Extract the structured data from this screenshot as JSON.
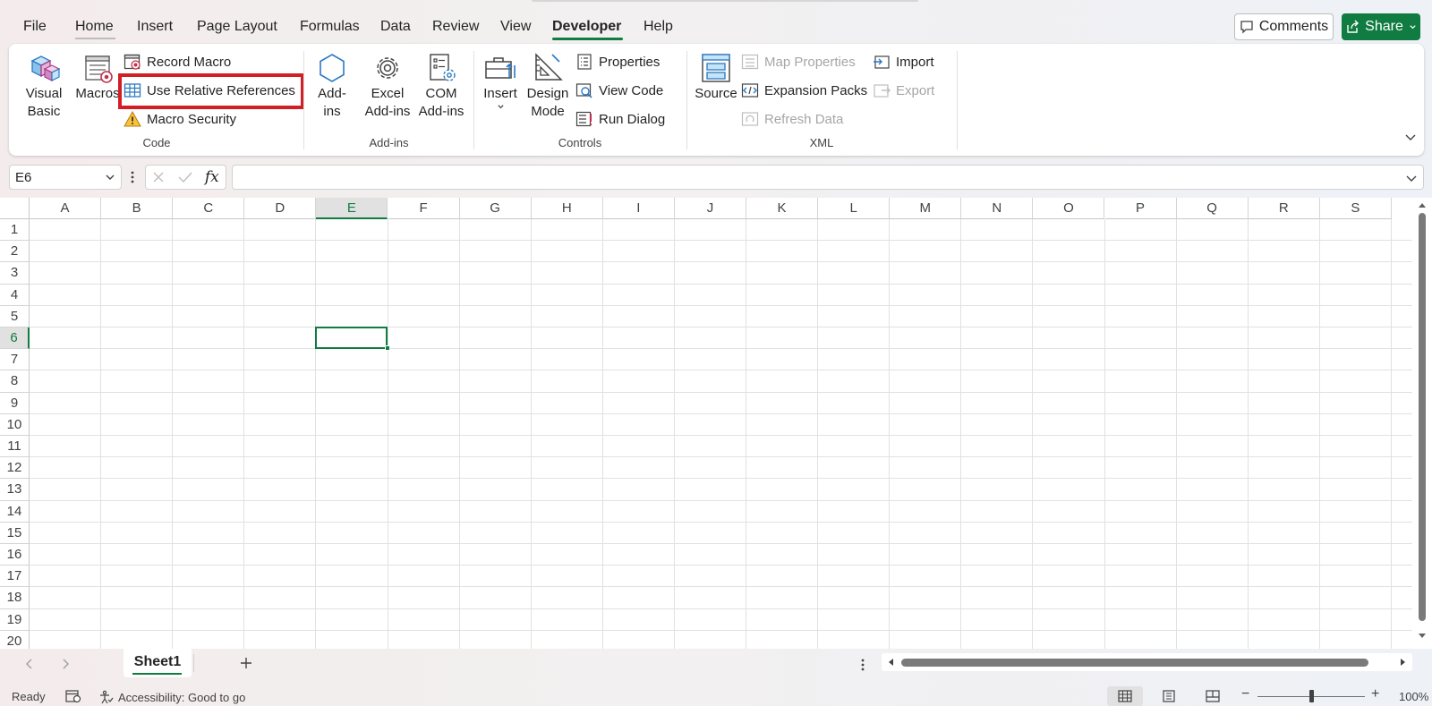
{
  "menu": {
    "tabs": [
      {
        "label": "File"
      },
      {
        "label": "Home"
      },
      {
        "label": "Insert"
      },
      {
        "label": "Page Layout"
      },
      {
        "label": "Formulas"
      },
      {
        "label": "Data"
      },
      {
        "label": "Review"
      },
      {
        "label": "View"
      },
      {
        "label": "Developer"
      },
      {
        "label": "Help"
      }
    ],
    "active_tab": "Developer",
    "comments_label": "Comments",
    "share_label": "Share"
  },
  "ribbon": {
    "code": {
      "group_label": "Code",
      "visual_basic": "Visual\nBasic",
      "macros": "Macros",
      "record_macro": "Record Macro",
      "use_relative_references": "Use Relative References",
      "macro_security": "Macro Security"
    },
    "addins": {
      "group_label": "Add-ins",
      "add_ins": "Add-\nins",
      "excel_add_ins": "Excel\nAdd-ins",
      "com_add_ins": "COM\nAdd-ins"
    },
    "controls": {
      "group_label": "Controls",
      "insert": "Insert",
      "design_mode": "Design\nMode",
      "properties": "Properties",
      "view_code": "View Code",
      "run_dialog": "Run Dialog"
    },
    "xml": {
      "group_label": "XML",
      "source": "Source",
      "map_properties": "Map Properties",
      "expansion_packs": "Expansion Packs",
      "refresh_data": "Refresh Data",
      "import": "Import",
      "export": "Export"
    }
  },
  "formula_bar": {
    "name_box": "E6",
    "fx_label": "fx",
    "formula_value": ""
  },
  "grid": {
    "columns": [
      "A",
      "B",
      "C",
      "D",
      "E",
      "F",
      "G",
      "H",
      "I",
      "J",
      "K",
      "L",
      "M",
      "N",
      "O",
      "P",
      "Q",
      "R",
      "S"
    ],
    "rows": [
      "1",
      "2",
      "3",
      "4",
      "5",
      "6",
      "7",
      "8",
      "9",
      "10",
      "11",
      "12",
      "13",
      "14",
      "15",
      "16",
      "17",
      "18",
      "19",
      "20"
    ],
    "active_column": "E",
    "active_row": "6"
  },
  "sheet_tabs": {
    "tabs": [
      "Sheet1"
    ],
    "active": "Sheet1"
  },
  "status_bar": {
    "ready": "Ready",
    "accessibility": "Accessibility: Good to go",
    "zoom": "100%"
  },
  "colors": {
    "accent": "#107c41",
    "highlight": "#d21f26"
  }
}
